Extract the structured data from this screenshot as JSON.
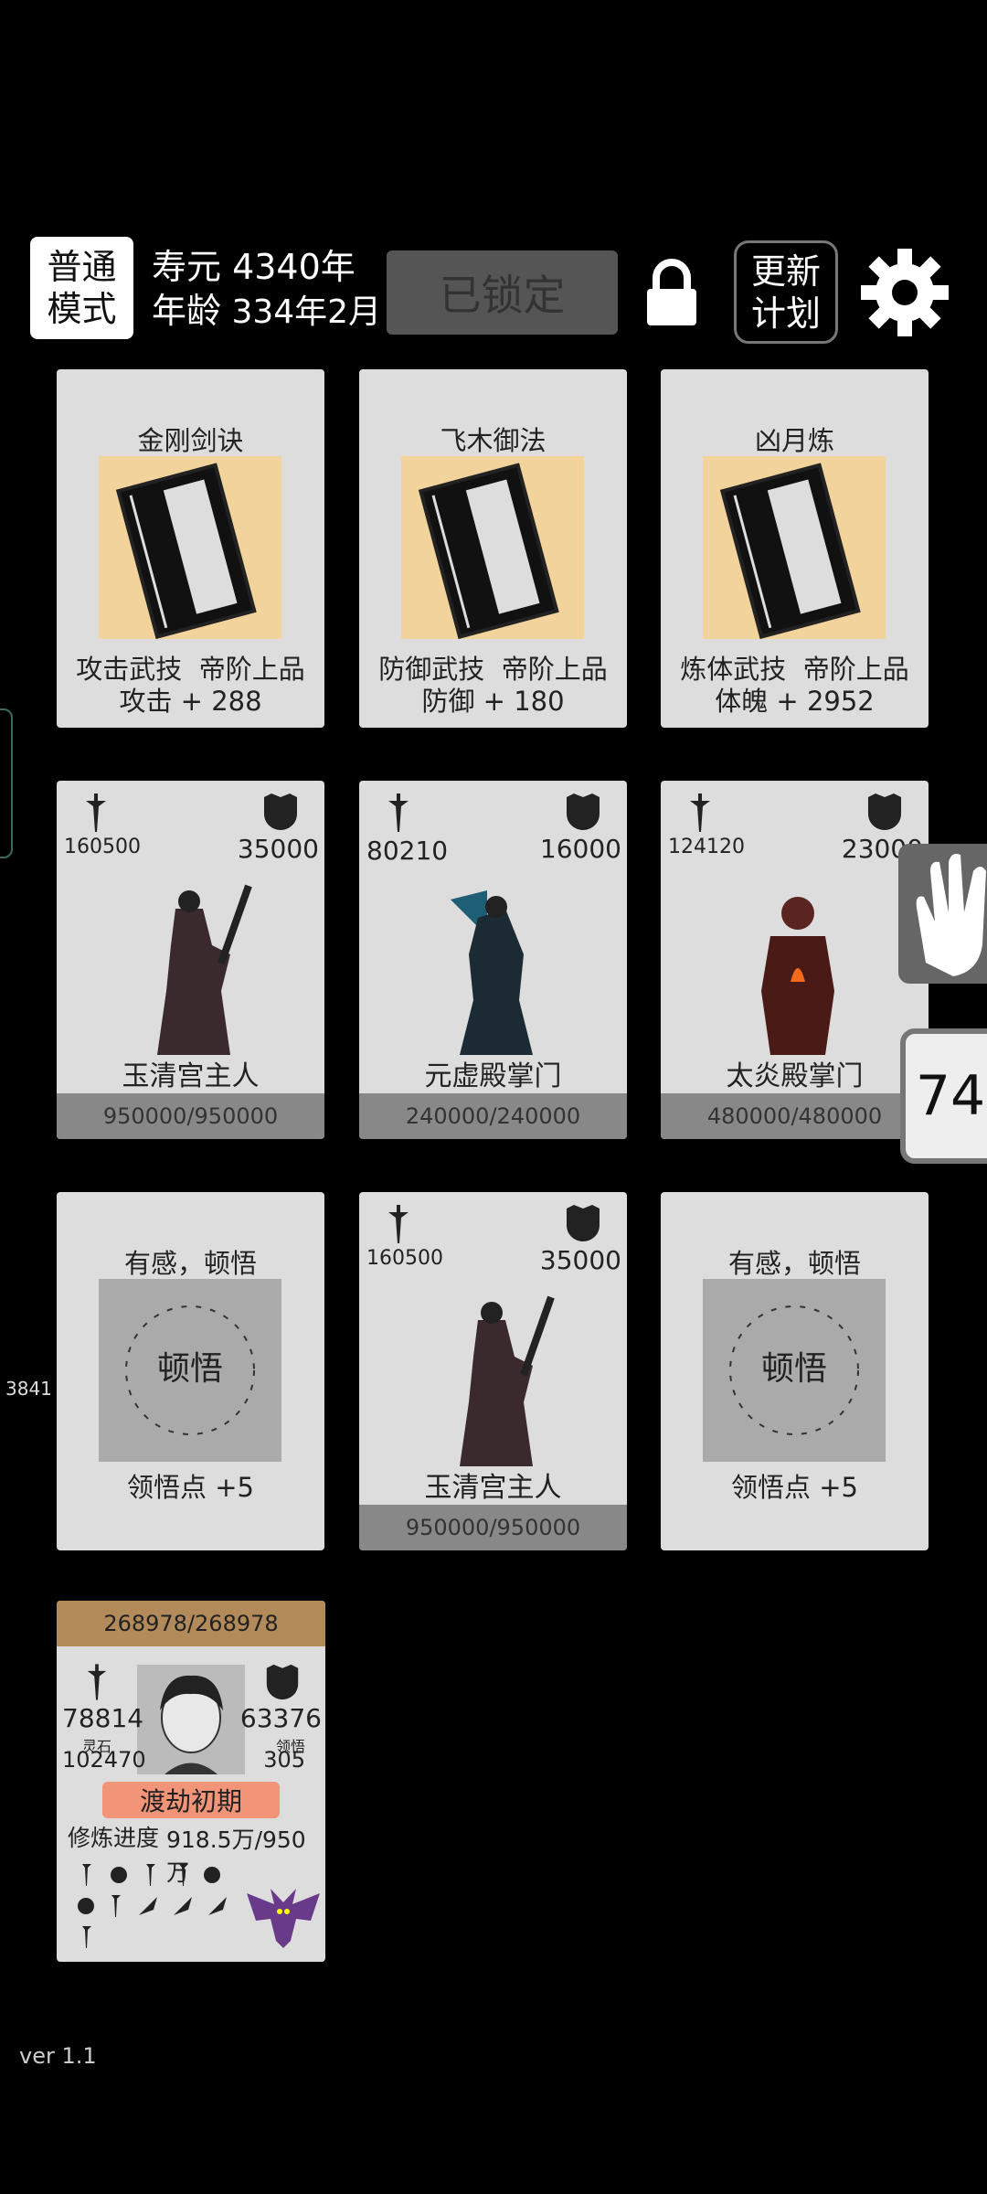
{
  "topbar": {
    "mode": [
      "普通",
      "模式"
    ],
    "lifespan": "寿元 4340年",
    "age_label": "年龄",
    "age_value": "334年2月",
    "locked_label": "已锁定",
    "update": [
      "更新",
      "计划"
    ]
  },
  "skill_cards": [
    {
      "name": "金刚剑诀",
      "type": "攻击武技",
      "rank": "帝阶上品",
      "bonus": "攻击 + 288"
    },
    {
      "name": "飞木御法",
      "type": "防御武技",
      "rank": "帝阶上品",
      "bonus": "防御 + 180"
    },
    {
      "name": "凶月炼",
      "type": "炼体武技",
      "rank": "帝阶上品",
      "bonus": "体魄 + 2952"
    }
  ],
  "enemies": [
    {
      "atk": "160500",
      "def": "35000",
      "name": "玉清宫主人",
      "hp": "950000/950000"
    },
    {
      "atk": "80210",
      "def": "16000",
      "name": "元虚殿掌门",
      "hp": "240000/240000"
    },
    {
      "atk": "124120",
      "def": "23000",
      "name": "太炎殿掌门",
      "hp": "480000/480000"
    }
  ],
  "row3": {
    "insight_title": "有感，顿悟",
    "insight_reward": "领悟点  +5",
    "enemy": {
      "atk": "160500",
      "def": "35000",
      "name": "玉清宫主人",
      "hp": "950000/950000"
    }
  },
  "player": {
    "hp": "268978/268978",
    "atk": "78814",
    "def": "63376",
    "atk_sub": "灵石",
    "def_sub": "领悟",
    "spirit_stones": "102470",
    "insight_points": "305",
    "realm": "渡劫初期",
    "progress_label": "修炼进度",
    "progress_value": "918.5万/950万"
  },
  "side": {
    "timer": "74",
    "left_number": "3841"
  },
  "version": "ver 1.1"
}
